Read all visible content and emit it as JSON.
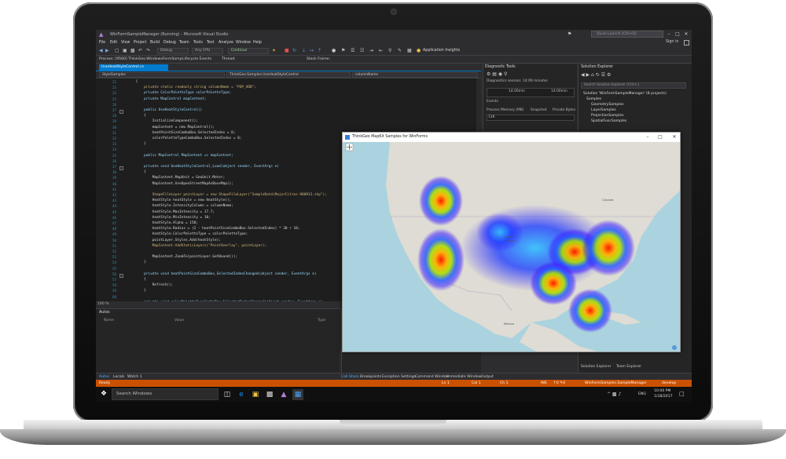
{
  "window": {
    "title": "WinFormSampleManager (Running) - Microsoft Visual Studio",
    "quick_launch": "Quick Launch (Ctrl+Q)",
    "sign_in": "Sign in"
  },
  "menu": [
    "File",
    "Edit",
    "View",
    "Project",
    "Build",
    "Debug",
    "Team",
    "Tools",
    "Test",
    "Analyze",
    "Window",
    "Help"
  ],
  "toolbar": {
    "config": "Debug",
    "platform": "Any CPU",
    "continue_label": "Continue",
    "app_insights": "Application Insights"
  },
  "process_bar": {
    "process": "Process: [9560] ThinkGeo.WindowsFormSamp",
    "lifecycle": "Lifecycle Events",
    "thread": "Thread:",
    "stack_frame": "Stack Frame:"
  },
  "editor": {
    "tab": "UseHeatStyleControl.cs",
    "nav_left": "StyleSamples",
    "nav_mid": "ThinkGeo.Samples.UseHeatStyleControl",
    "nav_right": "columnName",
    "zoom": "100 %",
    "line_numbers": [
      "22",
      "23",
      "24",
      "25",
      "26",
      "27",
      "28",
      "29",
      "30",
      "31",
      "32",
      "33",
      "34",
      "35",
      "36",
      "37",
      "38",
      "39",
      "40",
      "41",
      "42",
      "43",
      "44",
      "45",
      "46",
      "47",
      "48",
      "49",
      "50",
      "51",
      "52",
      "53",
      "54",
      "55",
      "56",
      "57",
      "58",
      "59",
      "60"
    ],
    "lines": [
      "    {",
      "        private static readonly string columnName = \"POP_ADB\";",
      "        private ColorPaletteType colorPaletteType;",
      "        private MapControl mapContent;",
      "",
      "        public UseHeatStyleControl()",
      "        {",
      "            InitializeComponent();",
      "            mapContent = new MapControl();",
      "            heatPointSizeComboBox.SelectedIndex = 0;",
      "            colorPaletteTypeComboBox.SelectedIndex = 0;",
      "        }",
      "",
      "        public MapControl MapContent => mapContent;",
      "",
      "        private void UseHeatStyleControl_Load(object sender, EventArgs e)",
      "        {",
      "            MapContent.MapUnit = GeoUnit.Meter;",
      "            MapContent.UseOpenStreetMapAsBaseMap();",
      "",
      "            ShapeFileLayer pointLayer = new ShapeFileLayer(\"SampleData\\MajorCities-900913.shp\");",
      "            HeatStyle heatStyle = new HeatStyle();",
      "            heatStyle.IntensityColumn = columnName;",
      "            heatStyle.MaxIntensity = 17.7;",
      "            heatStyle.MinIntensity = 10;",
      "            heatStyle.Alpha = 150;",
      "            heatStyle.Radius = (2 - heatPointSizeComboBox.SelectedIndex) * 30 + 10;",
      "            heatStyle.ColorPaletteType = colorPaletteType;",
      "            pointLayer.Styles.Add(heatStyle);",
      "            MapContent.AddStaticLayers(\"PointOverlay\", pointLayer);",
      "",
      "            MapContent.ZoomTo(pointLayer.GetBound());",
      "        }",
      "",
      "        private void heatPointSizeComboBox_SelectedIndexChanged(object sender, EventArgs e)",
      "        {",
      "            Refresh();",
      "        }",
      "",
      "        private void colorPaletteTypeComboBox_SelectedIndexChanged(object sender, EventArgs e)"
    ]
  },
  "autos": {
    "title": "Autos",
    "col_name": "Name",
    "col_value": "Value",
    "col_type": "Type"
  },
  "diagnostics": {
    "title": "Diagnostic Tools",
    "session": "Diagnostics session: 14:09 minutes",
    "tick1": "14:00min",
    "tick2": "14:00min",
    "events": "Events",
    "process_memory": "Process Memory (MB)",
    "snapshot": "Snapshot",
    "private_bytes": "Private Bytes",
    "mem_value": "136"
  },
  "solution_explorer": {
    "title": "Solution Explorer",
    "search_placeholder": "Search Solution Explorer (Ctrl+;)",
    "items": [
      "Solution 'WinFormSampleManager' (8 projects)",
      "Samples",
      "GeometrySamples",
      "LayerSamples",
      "ProjectionSamples",
      "SpatialFuncSamples"
    ],
    "footer_left": "Solution Explorer",
    "footer_right": "Team Explorer"
  },
  "map_window": {
    "title": "ThinkGeo MapKit Samples for WinForms",
    "labels": {
      "mexico": "México",
      "united": "United",
      "states": "States",
      "canada": "Canada"
    }
  },
  "bottom_tabs": [
    "Autos",
    "Locals",
    "Watch 1",
    "Call Stack",
    "Breakpoints",
    "Exception Settings",
    "Command Window",
    "Immediate Window",
    "Output"
  ],
  "status_bar": {
    "ready": "Ready",
    "ln": "Ln 1",
    "col": "Col 1",
    "ch": "Ch 1",
    "ins": "INS",
    "solution": "WinFormSamples.SampleManager",
    "branch": "develop"
  },
  "taskbar": {
    "search": "Search Windows",
    "lang": "ENG",
    "time": "10:00 PM",
    "date": "1/18/2017"
  },
  "colors": {
    "vs_accent": "#007acc",
    "status_bar": "#ca5100",
    "heat_core": "#ff2000",
    "heat_mid": "#ffd000",
    "heat_low": "#2030ff"
  }
}
